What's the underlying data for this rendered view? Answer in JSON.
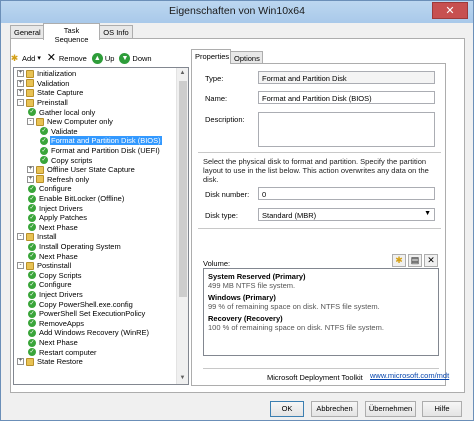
{
  "window": {
    "title": "Eigenschaften von Win10x64",
    "close_glyph": "✕"
  },
  "tabs": [
    "General",
    "Task Sequence",
    "OS Info"
  ],
  "toolbar": {
    "add": "Add",
    "add_caret": "▾",
    "remove": "Remove",
    "up": "Up",
    "down": "Down"
  },
  "tree": [
    {
      "label": "Initialization",
      "level": 1,
      "icon": "folder",
      "expander": "+"
    },
    {
      "label": "Validation",
      "level": 1,
      "icon": "folder",
      "expander": "+"
    },
    {
      "label": "State Capture",
      "level": 1,
      "icon": "folder",
      "expander": "+"
    },
    {
      "label": "Preinstall",
      "level": 1,
      "icon": "folder",
      "expander": "-"
    },
    {
      "label": "Gather local only",
      "level": 2,
      "icon": "check"
    },
    {
      "label": "New Computer only",
      "level": 2,
      "icon": "folder",
      "expander": "-"
    },
    {
      "label": "Validate",
      "level": 3,
      "icon": "check"
    },
    {
      "label": "Format and Partition Disk (BIOS)",
      "level": 3,
      "icon": "check",
      "selected": true
    },
    {
      "label": "Format and Partition Disk (UEFI)",
      "level": 3,
      "icon": "check"
    },
    {
      "label": "Copy scripts",
      "level": 3,
      "icon": "check"
    },
    {
      "label": "Offline User State Capture",
      "level": 2,
      "icon": "folder",
      "expander": "+"
    },
    {
      "label": "Refresh only",
      "level": 2,
      "icon": "folder",
      "expander": "+"
    },
    {
      "label": "Configure",
      "level": 2,
      "icon": "check"
    },
    {
      "label": "Enable BitLocker (Offline)",
      "level": 2,
      "icon": "check"
    },
    {
      "label": "Inject Drivers",
      "level": 2,
      "icon": "check"
    },
    {
      "label": "Apply Patches",
      "level": 2,
      "icon": "check"
    },
    {
      "label": "Next Phase",
      "level": 2,
      "icon": "check"
    },
    {
      "label": "Install",
      "level": 1,
      "icon": "folder",
      "expander": "-"
    },
    {
      "label": "Install Operating System",
      "level": 2,
      "icon": "check"
    },
    {
      "label": "Next Phase",
      "level": 2,
      "icon": "check"
    },
    {
      "label": "Postinstall",
      "level": 1,
      "icon": "folder",
      "expander": "-"
    },
    {
      "label": "Copy Scripts",
      "level": 2,
      "icon": "check"
    },
    {
      "label": "Configure",
      "level": 2,
      "icon": "check"
    },
    {
      "label": "Inject Drivers",
      "level": 2,
      "icon": "check"
    },
    {
      "label": "Copy PowerShell.exe.config",
      "level": 2,
      "icon": "check"
    },
    {
      "label": "PowerShell Set ExecutionPolicy",
      "level": 2,
      "icon": "check"
    },
    {
      "label": "RemoveApps",
      "level": 2,
      "icon": "check"
    },
    {
      "label": "Add Windows Recovery (WinRE)",
      "level": 2,
      "icon": "check"
    },
    {
      "label": "Next Phase",
      "level": 2,
      "icon": "check"
    },
    {
      "label": "Restart computer",
      "level": 2,
      "icon": "check"
    },
    {
      "label": "State Restore",
      "level": 1,
      "icon": "folder",
      "expander": "+"
    }
  ],
  "panel": {
    "tabs": [
      "Properties",
      "Options"
    ],
    "type_label": "Type:",
    "type_value": "Format and Partition Disk",
    "name_label": "Name:",
    "name_value": "Format and Partition Disk (BIOS)",
    "description_label": "Description:",
    "description_value": "",
    "instructions": "Select the physical disk to format and partition.  Specify the partition layout to use in the list below. This action overwrites any data on the disk.",
    "disk_number_label": "Disk number:",
    "disk_number_value": "0",
    "disk_type_label": "Disk type:",
    "disk_type_value": "Standard (MBR)",
    "volume_label": "Volume:",
    "volumes": [
      {
        "title": "System Reserved (Primary)",
        "detail": "499 MB NTFS file system."
      },
      {
        "title": "Windows (Primary)",
        "detail": "99 % of remaining space on disk. NTFS file system."
      },
      {
        "title": "Recovery (Recovery)",
        "detail": "100 % of remaining space on disk. NTFS file system."
      }
    ],
    "footer_left": "Microsoft Deployment Toolkit",
    "footer_link": "www.microsoft.com/mdt"
  },
  "buttons": {
    "ok": "OK",
    "cancel": "Abbrechen",
    "apply": "Übernehmen",
    "help": "Hilfe"
  },
  "colors": {
    "selection": "#3399ff",
    "check_icon": "#3aa53a",
    "folder_icon": "#e8c254",
    "close_button": "#c75050"
  }
}
